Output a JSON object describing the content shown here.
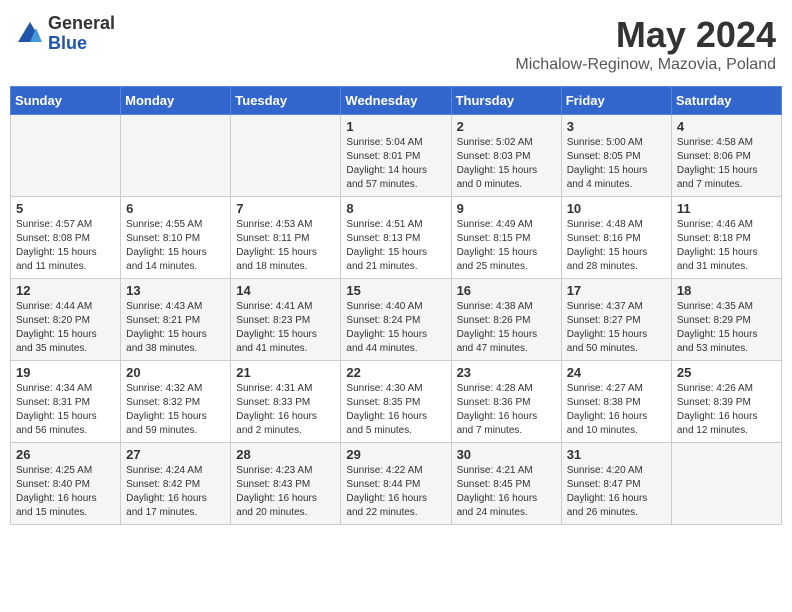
{
  "header": {
    "logo_general": "General",
    "logo_blue": "Blue",
    "month_title": "May 2024",
    "subtitle": "Michalow-Reginow, Mazovia, Poland"
  },
  "days_of_week": [
    "Sunday",
    "Monday",
    "Tuesday",
    "Wednesday",
    "Thursday",
    "Friday",
    "Saturday"
  ],
  "weeks": [
    [
      {
        "day": "",
        "info": ""
      },
      {
        "day": "",
        "info": ""
      },
      {
        "day": "",
        "info": ""
      },
      {
        "day": "1",
        "info": "Sunrise: 5:04 AM\nSunset: 8:01 PM\nDaylight: 14 hours\nand 57 minutes."
      },
      {
        "day": "2",
        "info": "Sunrise: 5:02 AM\nSunset: 8:03 PM\nDaylight: 15 hours\nand 0 minutes."
      },
      {
        "day": "3",
        "info": "Sunrise: 5:00 AM\nSunset: 8:05 PM\nDaylight: 15 hours\nand 4 minutes."
      },
      {
        "day": "4",
        "info": "Sunrise: 4:58 AM\nSunset: 8:06 PM\nDaylight: 15 hours\nand 7 minutes."
      }
    ],
    [
      {
        "day": "5",
        "info": "Sunrise: 4:57 AM\nSunset: 8:08 PM\nDaylight: 15 hours\nand 11 minutes."
      },
      {
        "day": "6",
        "info": "Sunrise: 4:55 AM\nSunset: 8:10 PM\nDaylight: 15 hours\nand 14 minutes."
      },
      {
        "day": "7",
        "info": "Sunrise: 4:53 AM\nSunset: 8:11 PM\nDaylight: 15 hours\nand 18 minutes."
      },
      {
        "day": "8",
        "info": "Sunrise: 4:51 AM\nSunset: 8:13 PM\nDaylight: 15 hours\nand 21 minutes."
      },
      {
        "day": "9",
        "info": "Sunrise: 4:49 AM\nSunset: 8:15 PM\nDaylight: 15 hours\nand 25 minutes."
      },
      {
        "day": "10",
        "info": "Sunrise: 4:48 AM\nSunset: 8:16 PM\nDaylight: 15 hours\nand 28 minutes."
      },
      {
        "day": "11",
        "info": "Sunrise: 4:46 AM\nSunset: 8:18 PM\nDaylight: 15 hours\nand 31 minutes."
      }
    ],
    [
      {
        "day": "12",
        "info": "Sunrise: 4:44 AM\nSunset: 8:20 PM\nDaylight: 15 hours\nand 35 minutes."
      },
      {
        "day": "13",
        "info": "Sunrise: 4:43 AM\nSunset: 8:21 PM\nDaylight: 15 hours\nand 38 minutes."
      },
      {
        "day": "14",
        "info": "Sunrise: 4:41 AM\nSunset: 8:23 PM\nDaylight: 15 hours\nand 41 minutes."
      },
      {
        "day": "15",
        "info": "Sunrise: 4:40 AM\nSunset: 8:24 PM\nDaylight: 15 hours\nand 44 minutes."
      },
      {
        "day": "16",
        "info": "Sunrise: 4:38 AM\nSunset: 8:26 PM\nDaylight: 15 hours\nand 47 minutes."
      },
      {
        "day": "17",
        "info": "Sunrise: 4:37 AM\nSunset: 8:27 PM\nDaylight: 15 hours\nand 50 minutes."
      },
      {
        "day": "18",
        "info": "Sunrise: 4:35 AM\nSunset: 8:29 PM\nDaylight: 15 hours\nand 53 minutes."
      }
    ],
    [
      {
        "day": "19",
        "info": "Sunrise: 4:34 AM\nSunset: 8:31 PM\nDaylight: 15 hours\nand 56 minutes."
      },
      {
        "day": "20",
        "info": "Sunrise: 4:32 AM\nSunset: 8:32 PM\nDaylight: 15 hours\nand 59 minutes."
      },
      {
        "day": "21",
        "info": "Sunrise: 4:31 AM\nSunset: 8:33 PM\nDaylight: 16 hours\nand 2 minutes."
      },
      {
        "day": "22",
        "info": "Sunrise: 4:30 AM\nSunset: 8:35 PM\nDaylight: 16 hours\nand 5 minutes."
      },
      {
        "day": "23",
        "info": "Sunrise: 4:28 AM\nSunset: 8:36 PM\nDaylight: 16 hours\nand 7 minutes."
      },
      {
        "day": "24",
        "info": "Sunrise: 4:27 AM\nSunset: 8:38 PM\nDaylight: 16 hours\nand 10 minutes."
      },
      {
        "day": "25",
        "info": "Sunrise: 4:26 AM\nSunset: 8:39 PM\nDaylight: 16 hours\nand 12 minutes."
      }
    ],
    [
      {
        "day": "26",
        "info": "Sunrise: 4:25 AM\nSunset: 8:40 PM\nDaylight: 16 hours\nand 15 minutes."
      },
      {
        "day": "27",
        "info": "Sunrise: 4:24 AM\nSunset: 8:42 PM\nDaylight: 16 hours\nand 17 minutes."
      },
      {
        "day": "28",
        "info": "Sunrise: 4:23 AM\nSunset: 8:43 PM\nDaylight: 16 hours\nand 20 minutes."
      },
      {
        "day": "29",
        "info": "Sunrise: 4:22 AM\nSunset: 8:44 PM\nDaylight: 16 hours\nand 22 minutes."
      },
      {
        "day": "30",
        "info": "Sunrise: 4:21 AM\nSunset: 8:45 PM\nDaylight: 16 hours\nand 24 minutes."
      },
      {
        "day": "31",
        "info": "Sunrise: 4:20 AM\nSunset: 8:47 PM\nDaylight: 16 hours\nand 26 minutes."
      },
      {
        "day": "",
        "info": ""
      }
    ]
  ]
}
